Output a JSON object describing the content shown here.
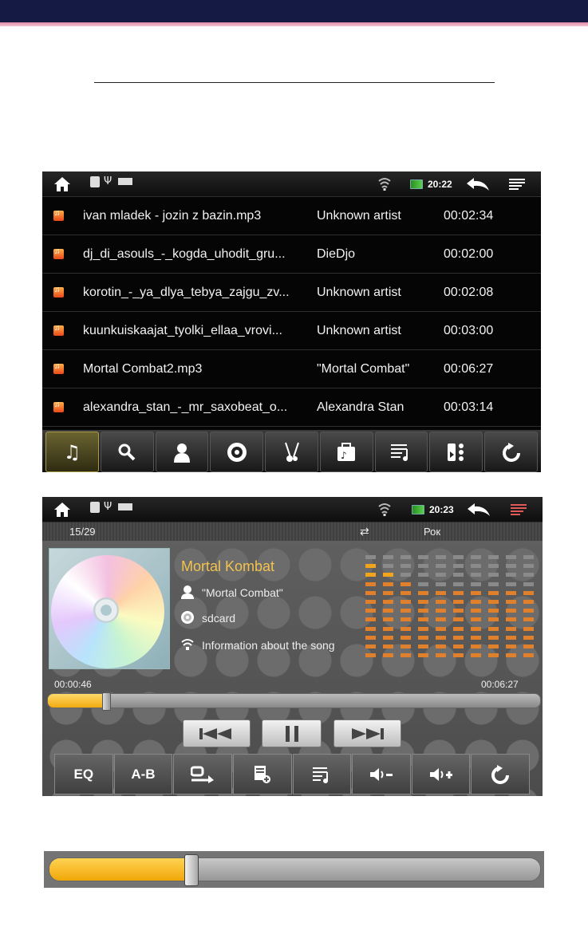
{
  "screen1": {
    "status": {
      "time": "20:22"
    },
    "rows": [
      {
        "name": "ivan mladek - jozin z bazin.mp3",
        "artist": "Unknown artist",
        "duration": "00:02:34"
      },
      {
        "name": "dj_di_asouls_-_kogda_uhodit_gru...",
        "artist": "DieDjo",
        "duration": "00:02:00"
      },
      {
        "name": "korotin_-_ya_dlya_tebya_zajgu_zv...",
        "artist": "Unknown artist",
        "duration": "00:02:08"
      },
      {
        "name": "kuunkuiskaajat_tyolki_ellaa_vrovi...",
        "artist": "Unknown artist",
        "duration": "00:03:00"
      },
      {
        "name": "Mortal Combat2.mp3",
        "artist": "\"Mortal Combat\"",
        "duration": "00:06:27"
      },
      {
        "name": "alexandra_stan_-_mr_saxobeat_o...",
        "artist": "Alexandra Stan",
        "duration": "00:03:14"
      }
    ],
    "tabs": [
      "music-note-icon",
      "search-icon",
      "artist-icon",
      "album-icon",
      "genre-icon",
      "folder-icon",
      "playlist-icon",
      "now-playing-icon",
      "refresh-icon"
    ]
  },
  "screen2": {
    "status": {
      "time": "20:23"
    },
    "track_counter": "15/29",
    "genre": "Рок",
    "title": "Mortal Kombat",
    "artist": "\"Mortal Combat\"",
    "storage": "sdcard",
    "info": "Information about the song",
    "time_current": "00:00:46",
    "time_total": "00:06:27",
    "progress": 0.119,
    "buttons": [
      "EQ",
      "A-B",
      "repeat-mode-icon",
      "add-to-playlist-icon",
      "playlist-icon",
      "volume-down-icon",
      "volume-up-icon",
      "refresh-icon"
    ],
    "eq_levels": [
      11,
      10,
      9,
      8,
      8,
      8,
      8,
      8,
      8,
      8
    ],
    "colors": {
      "accent": "#f3c34e",
      "progress": "#f1ab10"
    }
  },
  "slider_zoom": {
    "progress": 0.29
  }
}
